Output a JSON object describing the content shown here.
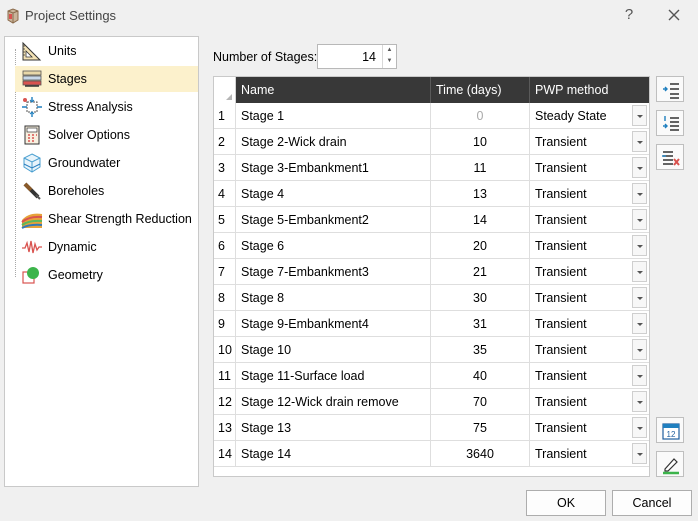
{
  "window": {
    "title": "Project Settings",
    "help_glyph": "?",
    "colors": {
      "selected_bg": "#fcf1cc",
      "grid_header_bg": "#383838"
    }
  },
  "tree": {
    "items": [
      {
        "label": "Units",
        "icon": "units-icon"
      },
      {
        "label": "Stages",
        "icon": "stages-icon",
        "selected": true
      },
      {
        "label": "Stress Analysis",
        "icon": "stress-analysis-icon"
      },
      {
        "label": "Solver Options",
        "icon": "solver-options-icon"
      },
      {
        "label": "Groundwater",
        "icon": "groundwater-icon"
      },
      {
        "label": "Boreholes",
        "icon": "boreholes-icon"
      },
      {
        "label": "Shear Strength Reduction",
        "icon": "shear-strength-icon"
      },
      {
        "label": "Dynamic",
        "icon": "dynamic-icon"
      },
      {
        "label": "Geometry",
        "icon": "geometry-icon"
      }
    ]
  },
  "stages": {
    "label": "Number of Stages:",
    "value": "14"
  },
  "grid": {
    "headers": {
      "name": "Name",
      "time": "Time (days)",
      "pwp": "PWP method"
    },
    "rows": [
      {
        "num": "1",
        "name": "Stage 1",
        "time": "0",
        "pwp": "Steady State"
      },
      {
        "num": "2",
        "name": "Stage 2-Wick drain",
        "time": "10",
        "pwp": "Transient"
      },
      {
        "num": "3",
        "name": "Stage 3-Embankment1",
        "time": "11",
        "pwp": "Transient"
      },
      {
        "num": "4",
        "name": "Stage 4",
        "time": "13",
        "pwp": "Transient"
      },
      {
        "num": "5",
        "name": "Stage 5-Embankment2",
        "time": "14",
        "pwp": "Transient"
      },
      {
        "num": "6",
        "name": "Stage 6",
        "time": "20",
        "pwp": "Transient"
      },
      {
        "num": "7",
        "name": "Stage 7-Embankment3",
        "time": "21",
        "pwp": "Transient"
      },
      {
        "num": "8",
        "name": "Stage 8",
        "time": "30",
        "pwp": "Transient"
      },
      {
        "num": "9",
        "name": "Stage 9-Embankment4",
        "time": "31",
        "pwp": "Transient"
      },
      {
        "num": "10",
        "name": "Stage 10",
        "time": "35",
        "pwp": "Transient"
      },
      {
        "num": "11",
        "name": "Stage 11-Surface load",
        "time": "40",
        "pwp": "Transient"
      },
      {
        "num": "12",
        "name": "Stage 12-Wick drain remove",
        "time": "70",
        "pwp": "Transient"
      },
      {
        "num": "13",
        "name": "Stage 13",
        "time": "75",
        "pwp": "Transient"
      },
      {
        "num": "14",
        "name": "Stage 14",
        "time": "3640",
        "pwp": "Transient"
      }
    ]
  },
  "side_buttons": [
    "insert-stage-icon",
    "add-stage-icon",
    "delete-stage-icon",
    "calendar-icon",
    "edit-icon"
  ],
  "footer": {
    "ok_label": "OK",
    "cancel_label": "Cancel"
  }
}
